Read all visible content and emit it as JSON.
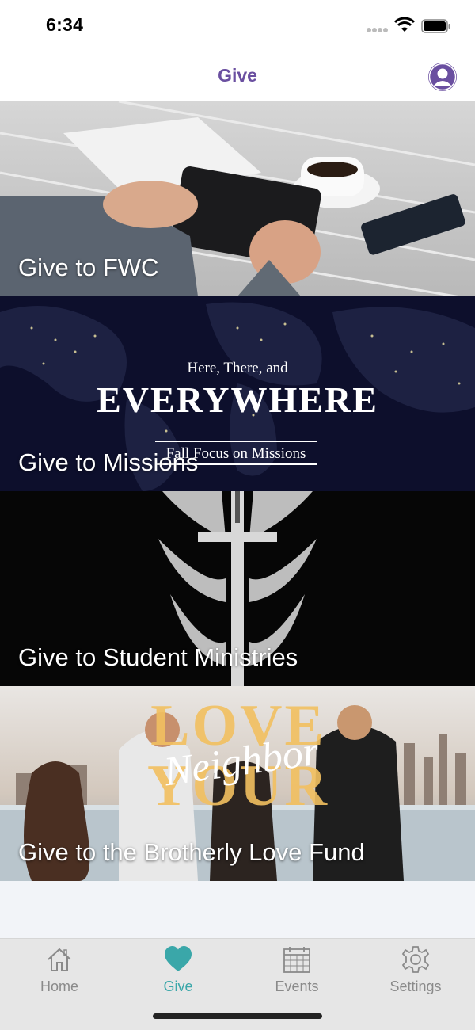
{
  "status_bar": {
    "time": "6:34"
  },
  "nav": {
    "title": "Give",
    "profile_icon": "person-icon"
  },
  "cards": [
    {
      "label": "Give to FWC"
    },
    {
      "label": "Give to Missions",
      "image_text": {
        "line1": "Here, There, and",
        "line2": "EVERYWHERE",
        "line3": "Fall Focus on Missions"
      }
    },
    {
      "label": "Give to Student Ministries"
    },
    {
      "label": "Give to the Brotherly Love Fund",
      "image_text": {
        "love": "LOVE",
        "your": "YOUR",
        "script": "Neighbor"
      }
    }
  ],
  "tabs": [
    {
      "label": "Home",
      "icon": "home-icon",
      "active": false
    },
    {
      "label": "Give",
      "icon": "heart-icon",
      "active": true
    },
    {
      "label": "Events",
      "icon": "calendar-icon",
      "active": false
    },
    {
      "label": "Settings",
      "icon": "gear-icon",
      "active": false
    }
  ],
  "colors": {
    "accent": "#6a4fa0",
    "active_tab": "#3aa7a9",
    "inactive_tab": "#8a8a8a"
  }
}
